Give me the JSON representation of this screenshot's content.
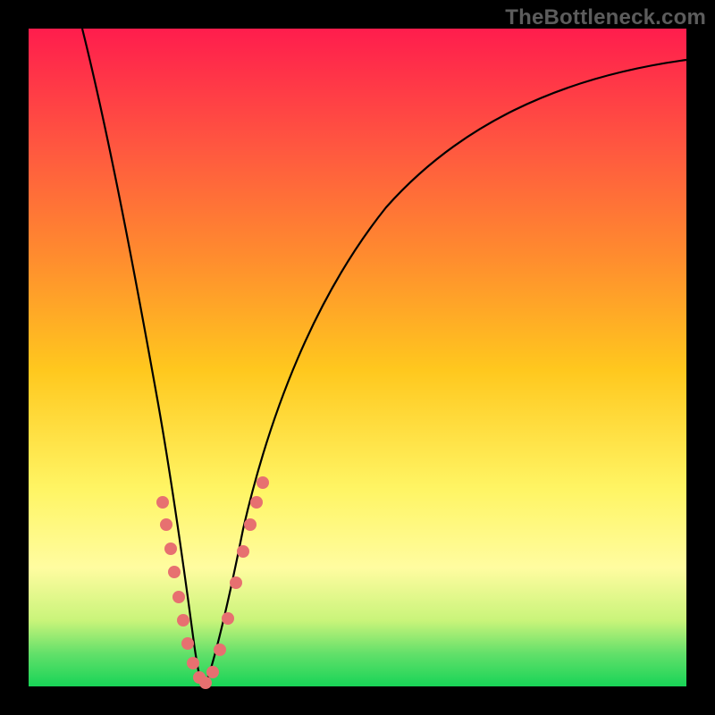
{
  "watermark": "TheBottleneck.com",
  "colors": {
    "frame": "#000000",
    "gradient_top": "#ff1d4d",
    "gradient_bottom": "#18d457",
    "curve": "#000000",
    "marker": "#e77070"
  },
  "chart_data": {
    "type": "line",
    "title": "",
    "xlabel": "",
    "ylabel": "",
    "xlim": [
      0,
      100
    ],
    "ylim": [
      0,
      100
    ],
    "grid": false,
    "series": [
      {
        "name": "bottleneck-curve",
        "x": [
          5,
          8,
          11,
          14,
          17,
          19,
          21,
          22.5,
          24,
          25.5,
          27,
          29,
          32,
          36,
          41,
          47,
          54,
          62,
          71,
          80,
          90,
          100
        ],
        "values": [
          100,
          83,
          67,
          53,
          40,
          30,
          20,
          12,
          5,
          1,
          4,
          12,
          25,
          40,
          53,
          64,
          73,
          80,
          85,
          89,
          92,
          94
        ]
      }
    ],
    "markers": {
      "name": "highlighted-points",
      "x_approx": [
        19.5,
        20.0,
        20.7,
        21.2,
        21.8,
        22.3,
        23.0,
        23.6,
        24.5,
        25.4,
        26.2,
        27.0,
        28.5,
        29.4,
        30.4,
        31.2,
        32.0,
        33.0
      ],
      "values_approx": [
        28,
        24,
        20,
        17,
        14,
        11,
        8,
        5,
        2,
        1,
        3,
        6,
        13,
        18,
        22,
        26,
        28,
        32
      ]
    },
    "notes": "Values are approximate percentages read off the gradient; x is an arbitrary 0–100 horizontal position. The curve is a V-shaped bottleneck profile with minimum near x≈25."
  }
}
